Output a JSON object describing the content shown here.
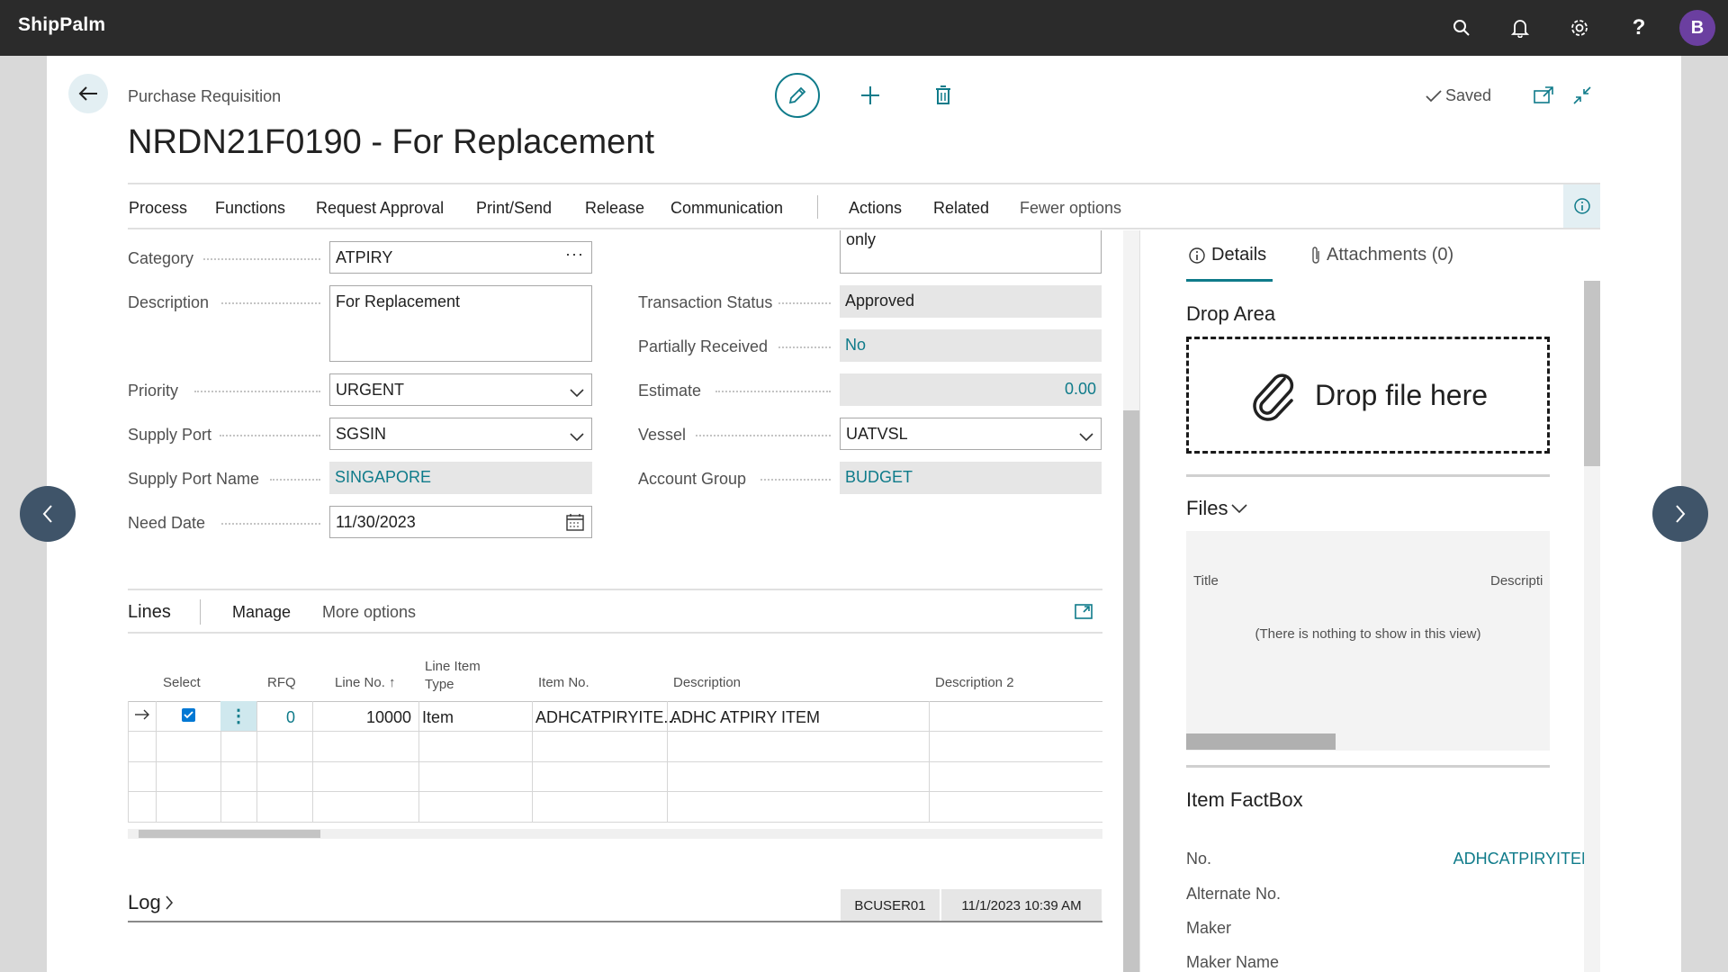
{
  "app": {
    "name": "ShipPalm",
    "user_initial": "B"
  },
  "header": {
    "caption": "Purchase Requisition",
    "title": "NRDN21F0190 - For Replacement",
    "saved_label": "Saved"
  },
  "actions": [
    "Process",
    "Functions",
    "Request Approval",
    "Print/Send",
    "Release",
    "Communication",
    "Actions",
    "Related",
    "Fewer options"
  ],
  "fields_left": {
    "category": {
      "label": "Category",
      "value": "ATPIRY"
    },
    "description": {
      "label": "Description",
      "value": "For Replacement"
    },
    "priority": {
      "label": "Priority",
      "value": "URGENT"
    },
    "supply_port": {
      "label": "Supply Port",
      "value": "SGSIN"
    },
    "supply_port_name": {
      "label": "Supply Port Name",
      "value": "SINGAPORE"
    },
    "need_date": {
      "label": "Need Date",
      "value": "11/30/2023"
    }
  },
  "fields_right": {
    "notes_tail": "only",
    "transaction_status": {
      "label": "Transaction Status",
      "value": "Approved"
    },
    "partially_received": {
      "label": "Partially Received",
      "value": "No"
    },
    "estimate": {
      "label": "Estimate",
      "value": "0.00"
    },
    "vessel": {
      "label": "Vessel",
      "value": "UATVSL"
    },
    "account_group": {
      "label": "Account Group",
      "value": "BUDGET"
    }
  },
  "lines": {
    "title": "Lines",
    "manage": "Manage",
    "more_options": "More options",
    "columns": {
      "select": "Select",
      "rfq": "RFQ",
      "line_no": "Line No. ↑",
      "line_item_type_1": "Line Item",
      "line_item_type_2": "Type",
      "item_no": "Item No.",
      "description": "Description",
      "description2": "Description 2"
    },
    "row": {
      "rfq": "0",
      "line_no": "10000",
      "type": "Item",
      "item_no": "ADHCATPIRYITE...",
      "description": "ADHC ATPIRY ITEM",
      "description2": ""
    }
  },
  "log": {
    "title": "Log",
    "user": "BCUSER01",
    "timestamp": "11/1/2023 10:39 AM"
  },
  "factbox": {
    "tab_details": "Details",
    "tab_attachments": "Attachments (0)",
    "drop_area_title": "Drop Area",
    "drop_text": "Drop file here",
    "files_title": "Files",
    "files_col_title": "Title",
    "files_col_description": "Descripti",
    "files_empty": "(There is nothing to show in this view)",
    "item_factbox_title": "Item FactBox",
    "rows": [
      {
        "label": "No.",
        "value": "ADHCATPIRYITEM"
      },
      {
        "label": "Alternate No.",
        "value": ""
      },
      {
        "label": "Maker",
        "value": ""
      },
      {
        "label": "Maker Name",
        "value": ""
      }
    ]
  },
  "colors": {
    "accent": "#0f7b8a",
    "appbar": "#2b2b2b",
    "avatar": "#6b3fa0",
    "nav_arrow": "#3f5469"
  }
}
